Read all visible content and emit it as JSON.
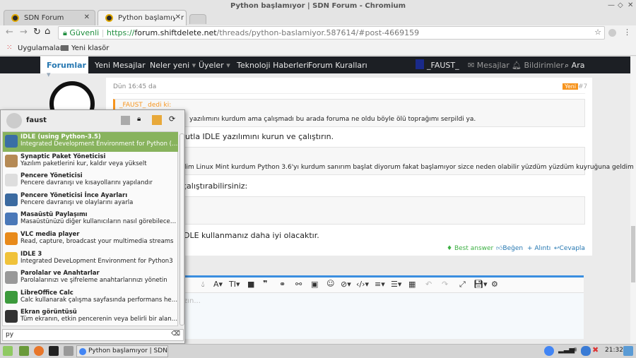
{
  "window": {
    "title": "Python başlamıyor | SDN Forum - Chromium"
  },
  "tabs": [
    {
      "label": "SDN Forum"
    },
    {
      "label": "Python başlamıyor | SD"
    }
  ],
  "address": {
    "secure_label": "Güvenli",
    "scheme": "https://",
    "host": "forum.shiftdelete.net",
    "path": "/threads/python-baslamiyor.587614/#post-4669159"
  },
  "bookmarks": [
    {
      "label": "Uygulamalar"
    },
    {
      "label": "Yeni klasör"
    }
  ],
  "nav": {
    "items": [
      "Forumlar",
      "Yeni Mesajlar",
      "Neler yeni",
      "Üyeler",
      "Teknoloji Haberleri",
      "Forum Kuralları"
    ],
    "user": "_FAUST_",
    "messages": "Mesajlar",
    "alerts": "Bildirimler",
    "search": "Ara"
  },
  "post": {
    "date": "Dün 16:45 da",
    "badge": "Yeni",
    "number": "#7",
    "quote1_author": "_FAUST_ dedi ki:",
    "quote1_text": "yazılımını kurdum ama çalışmadı bu arada foruma ne oldu böyle ölü toprağımı serpildi ya.",
    "line1": "nutla IDLE yazılımını kurun ve çalıştırın.",
    "quote2_text": "lim Linux Mint kurdum Python 3.6'yı kurdum sanırım başlat diyorum fakat başlamıyor sizce neden olabilir yüzdüm yüzdüm kuyruğuna geldim ya!",
    "line2": "çalıştırabilirsiniz:",
    "line3": "DLE kullanmanız daha iyi olacaktır.",
    "actions": {
      "best": "Best answer",
      "like": "Beğen",
      "quote": "+ Alıntı",
      "reply": "Cevapla"
    }
  },
  "editor": {
    "placeholder": "zın..."
  },
  "menu": {
    "user": "faust",
    "search_value": "py",
    "items": [
      {
        "title": "IDLE (using Python-3.5)",
        "desc": "Integrated Development Environment for Python (using Py...",
        "color": "#3a6ea5"
      },
      {
        "title": "Synaptic Paket Yöneticisi",
        "desc": "Yazılım paketlerini kur, kaldır veya yükselt",
        "color": "#b58a55"
      },
      {
        "title": "Pencere Yöneticisi",
        "desc": "Pencere davranışı ve kısayollarını yapılandır",
        "color": "#dddddd"
      },
      {
        "title": "Pencere Yöneticisi İnce Ayarları",
        "desc": "Pencere davranışı ve olaylarını ayarla",
        "color": "#3b6aa0"
      },
      {
        "title": "Masaüstü Paylaşımı",
        "desc": "Masaüstünüzü diğer kullanıcıların nasıl görebileceklerini s...",
        "color": "#4a78b8"
      },
      {
        "title": "VLC media player",
        "desc": "Read, capture, broadcast your multimedia streams",
        "color": "#e88a1a"
      },
      {
        "title": "IDLE 3",
        "desc": "Integrated DeveLopment Environment for Python3",
        "color": "#f0c23a"
      },
      {
        "title": "Parolalar ve Anahtarlar",
        "desc": "Parolalarınızı ve şifreleme anahtarlarınızı yönetin",
        "color": "#999999"
      },
      {
        "title": "LibreOffice Calc",
        "desc": "Calc kullanarak çalışma sayfasında performans hesaplam...",
        "color": "#3c9a3c"
      },
      {
        "title": "Ekran görüntüsü",
        "desc": "Tüm ekranın, etkin pencerenin veya belirli bir alanın ekran ...",
        "color": "#333333"
      }
    ]
  },
  "taskbar": {
    "window": "Python başlamıyor | SDN Fo...",
    "clock": "21:32"
  }
}
